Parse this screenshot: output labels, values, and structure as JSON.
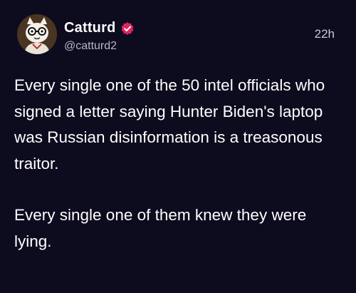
{
  "post": {
    "author": {
      "display_name": "Catturd",
      "handle": "@catturd2",
      "verified_icon": "verified-badge-icon",
      "avatar": "cartoon-cat-avatar"
    },
    "timestamp": "22h",
    "paragraphs": [
      "Every single one of the 50 intel officials who signed a letter saying Hunter Biden's laptop was Russian disinformation is a treasonous traitor.",
      "Every single one of them knew they were lying."
    ]
  },
  "colors": {
    "background": "#0d0b1e",
    "text": "#ffffff",
    "muted": "#b9b6c8",
    "verified_badge": "#e0245e"
  }
}
